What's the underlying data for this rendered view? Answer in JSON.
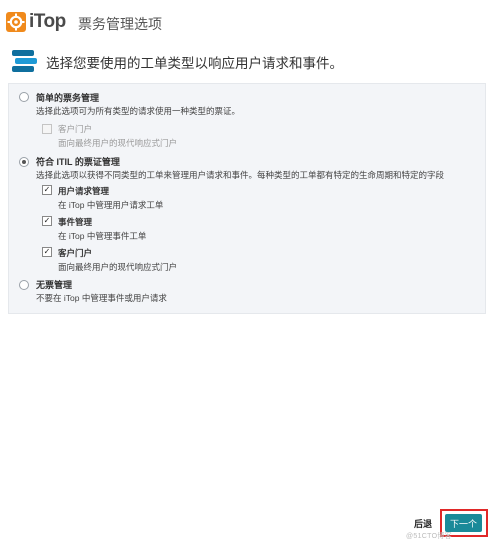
{
  "header": {
    "logo_text": "iTop",
    "title": "票务管理选项"
  },
  "question": "选择您要使用的工单类型以响应用户请求和事件。",
  "options": [
    {
      "title": "简单的票务管理",
      "description": "选择此选项可为所有类型的请求使用一种类型的票证。",
      "selected": false,
      "sub_items": [
        {
          "title": "客户门户",
          "description": "面向最终用户的现代响应式门户",
          "checked": false,
          "disabled": true
        }
      ]
    },
    {
      "title": "符合 ITIL 的票证管理",
      "description": "选择此选项以获得不同类型的工单来管理用户请求和事件。每种类型的工单都有特定的生命周期和特定的字段",
      "selected": true,
      "sub_items": [
        {
          "title": "用户请求管理",
          "description": "在 iTop 中管理用户请求工单",
          "checked": true,
          "disabled": false
        },
        {
          "title": "事件管理",
          "description": "在 iTop 中管理事件工单",
          "checked": true,
          "disabled": false
        },
        {
          "title": "客户门户",
          "description": "面向最终用户的现代响应式门户",
          "checked": true,
          "disabled": false
        }
      ]
    },
    {
      "title": "无票管理",
      "description": "不要在 iTop 中管理事件或用户请求",
      "selected": false,
      "sub_items": []
    }
  ],
  "footer": {
    "back_label": "后退",
    "next_label": "下一个",
    "watermark": "@51CTO博客"
  },
  "colors": {
    "next_button": "#1a8a99",
    "highlight_outline": "#e02828",
    "panel_background": "#f3f5f8",
    "logo_orange": "#f08a1c"
  },
  "icons": {
    "logo": "itop-gear-logo",
    "question": "stacked-layers-icon"
  }
}
